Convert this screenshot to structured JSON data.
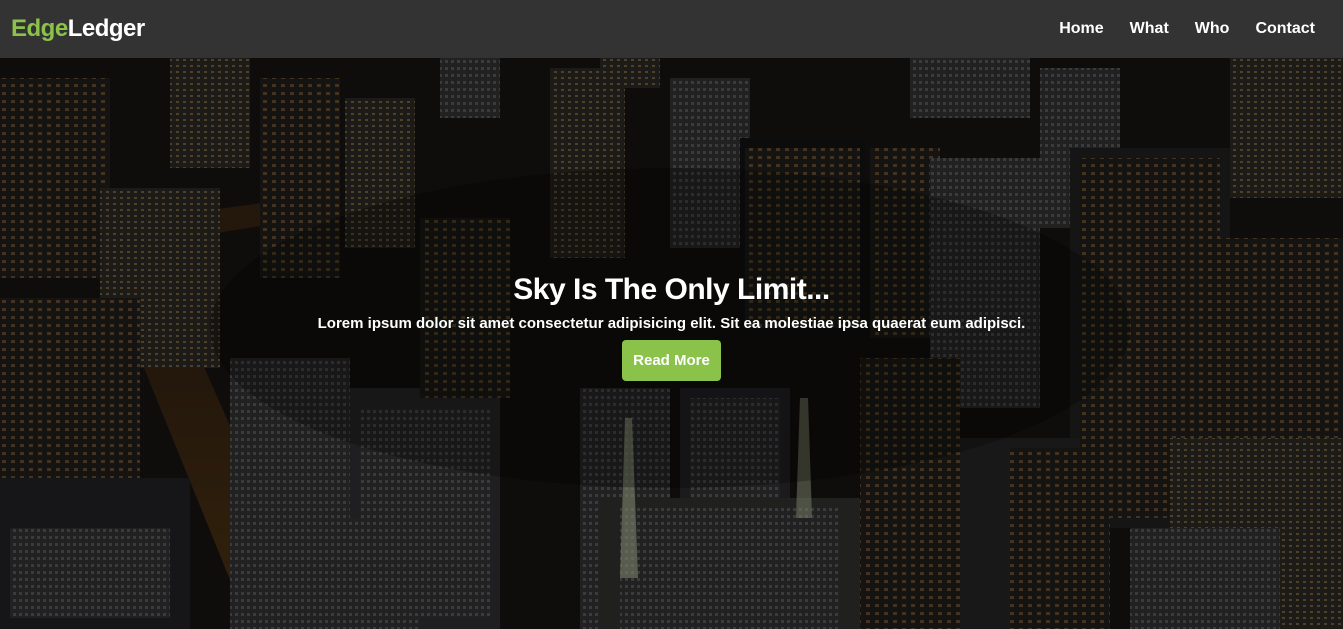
{
  "brand": {
    "part1": "Edge",
    "part2": "Ledger",
    "accent_color": "#8bc34a"
  },
  "nav": {
    "items": [
      "Home",
      "What",
      "Who",
      "Contact"
    ]
  },
  "hero": {
    "title": "Sky Is The Only Limit...",
    "subtitle": "Lorem ipsum dolor sit amet consectetur adipisicing elit. Sit ea molestiae ipsa quaerat eum adipisci.",
    "button_label": "Read More",
    "background": "night-city-aerial-photo"
  },
  "colors": {
    "navbar": "#333333",
    "button": "#8bc34a",
    "text": "#ffffff"
  }
}
